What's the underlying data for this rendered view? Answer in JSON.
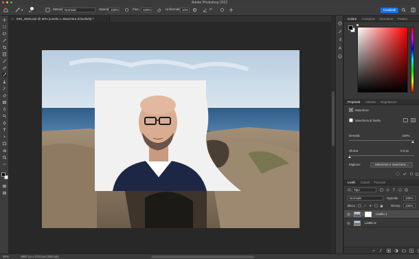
{
  "window": {
    "title": "Adobe Photoshop 2022"
  },
  "options_bar": {
    "mode_label": "Metodo:",
    "mode_value": "Normale",
    "opacity_label": "Opacità:",
    "opacity_value": "100%",
    "flow_label": "Flus.:",
    "flow_value": "100%",
    "smoothing_label": "Uniformità:",
    "smoothing_value": "10%",
    "angle_value": "0°",
    "brush_size": "60",
    "share_label": "Condividi"
  },
  "document": {
    "tab_title": "IMG_4500.psb @ 50% (Livello 1, Maschera di livello/8) *",
    "close_glyph": "×"
  },
  "status_bar": {
    "zoom": "50%",
    "doc_info": "3807 px x 2713 px (300 ppi)"
  },
  "color_panel": {
    "tabs": [
      "Colore",
      "Campioni",
      "Sfumature",
      "Pattern"
    ],
    "foreground_color": "#000000",
    "background_color": "#ffffff"
  },
  "properties_panel": {
    "tabs": [
      "Proprietà",
      "Librerie",
      "Regolazioni"
    ],
    "section_label": "Maschere",
    "mask_label": "Maschera di livello",
    "density_label": "Densità:",
    "density_value": "100%",
    "feather_label": "Sfuma:",
    "feather_value": "0,0 px",
    "refine_label": "Migliora:",
    "select_mask_button": "Seleziona e maschera..."
  },
  "layers_panel": {
    "tabs": [
      "Livelli",
      "Canali",
      "Tracciati"
    ],
    "filter_value": "Tipo",
    "blend_mode": "Normale",
    "opacity_label": "Opacità:",
    "opacity_value": "100%",
    "lock_label": "Blocc.:",
    "fill_label": "Riemp.:",
    "fill_value": "100%",
    "layers": [
      {
        "name": "Livello 1",
        "selected": true
      },
      {
        "name": "Livello 0",
        "selected": false
      }
    ]
  },
  "icons": [
    "home-icon",
    "brush-icon",
    "move-icon",
    "marquee-icon",
    "lasso-icon",
    "crop-icon",
    "eyedropper-icon",
    "eye-icon",
    "trash-icon"
  ]
}
